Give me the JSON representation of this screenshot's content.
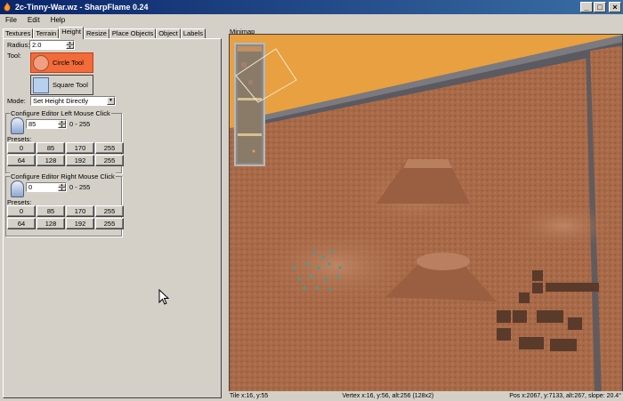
{
  "window": {
    "title": "2c-Tinny-War.wz - SharpFlame 0.24",
    "min_glyph": "_",
    "max_glyph": "□",
    "close_glyph": "×"
  },
  "menu": [
    "File",
    "Edit",
    "Help"
  ],
  "tabs": [
    "Textures",
    "Terrain",
    "Height",
    "Resize",
    "Place Objects",
    "Object",
    "Labels"
  ],
  "active_tab": "Height",
  "height": {
    "radius_label": "Radius:",
    "radius_value": "2.0",
    "tool_label": "Tool:",
    "circle_tool": "Circle Tool",
    "square_tool": "Square Tool",
    "mode_label": "Mode:",
    "mode_value": "Set Height Directly",
    "left": {
      "title": "Configure Editor Left Mouse Click",
      "value": "85",
      "range": "0 - 255",
      "presets_label": "Presets:",
      "presets": [
        "0",
        "85",
        "170",
        "255",
        "64",
        "128",
        "192",
        "255"
      ]
    },
    "right": {
      "title": "Configure Editor Right Mouse Click",
      "value": "0",
      "range": "0 - 255",
      "presets_label": "Presets:",
      "presets": [
        "0",
        "85",
        "170",
        "255",
        "64",
        "128",
        "192",
        "255"
      ]
    }
  },
  "view": {
    "minimap_label": "Minimap",
    "status_tile": "Tile x:16, y:55",
    "status_vertex": "Vertex  x:16, y:56, alt:256 (128x2)",
    "status_pos": "Pos x:2067, y:7133, alt:267, slope: 20.4°"
  },
  "colors": {
    "sky": "#e8a040",
    "ground": "#a86a48",
    "circle_tool_fill": "#f26b3a",
    "titlebar_start": "#0a246a",
    "titlebar_end": "#3a6ea5"
  }
}
